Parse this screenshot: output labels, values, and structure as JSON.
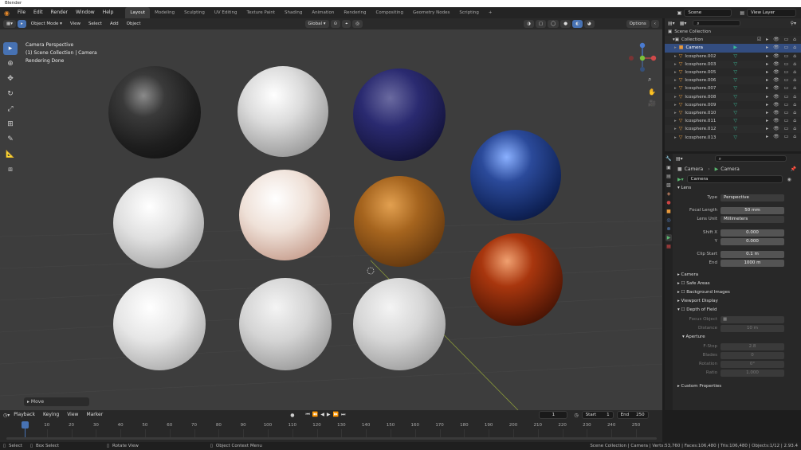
{
  "titlebar": {
    "title": "Blender"
  },
  "menu": {
    "items": [
      "File",
      "Edit",
      "Render",
      "Window",
      "Help"
    ]
  },
  "workspaces": [
    "Layout",
    "Modeling",
    "Sculpting",
    "UV Editing",
    "Texture Paint",
    "Shading",
    "Animation",
    "Rendering",
    "Compositing",
    "Geometry Nodes",
    "Scripting"
  ],
  "active_workspace": "Layout",
  "scene": {
    "label": "Scene",
    "view_layer": "View Layer"
  },
  "viewport_header": {
    "mode": "Object Mode",
    "menus": [
      "View",
      "Select",
      "Add",
      "Object"
    ],
    "orientation": "Global",
    "options": "Options"
  },
  "viewport_info": {
    "line1": "Camera Perspective",
    "line2": "(1) Scene Collection | Camera",
    "line3": "Rendering Done"
  },
  "last_operation": "Move",
  "outliner": {
    "root": "Scene Collection",
    "collection": "Collection",
    "items": [
      "Camera",
      "Icosphere.002",
      "Icosphere.003",
      "Icosphere.005",
      "Icosphere.006",
      "Icosphere.007",
      "Icosphere.008",
      "Icosphere.009",
      "Icosphere.010",
      "Icosphere.011",
      "Icosphere.012",
      "Icosphere.013"
    ]
  },
  "properties": {
    "breadcrumb_object": "Camera",
    "breadcrumb_data": "Camera",
    "datablock_name": "Camera",
    "lens_section": "Lens",
    "type_label": "Type",
    "type_value": "Perspective",
    "focal_label": "Focal Length",
    "focal_value": "50 mm",
    "lens_unit_label": "Lens Unit",
    "lens_unit_value": "Millimeters",
    "shift_x_label": "Shift X",
    "shift_x_value": "0.000",
    "shift_y_label": "Y",
    "shift_y_value": "0.000",
    "clip_start_label": "Clip Start",
    "clip_start_value": "0.1 m",
    "clip_end_label": "End",
    "clip_end_value": "1000 m",
    "sections": [
      "Camera",
      "Safe Areas",
      "Background Images",
      "Viewport Display",
      "Depth of Field"
    ],
    "focus_object_label": "Focus Object",
    "distance_label": "Distance",
    "distance_value": "10 m",
    "aperture_section": "Aperture",
    "fstop_label": "F-Stop",
    "fstop_value": "2.8",
    "blades_label": "Blades",
    "blades_value": "0",
    "rotation_label": "Rotation",
    "rotation_value": "0°",
    "ratio_label": "Ratio",
    "ratio_value": "1.000",
    "custom_props": "Custom Properties"
  },
  "timeline": {
    "menus": [
      "Playback",
      "Keying",
      "View",
      "Marker"
    ],
    "current_frame": "1",
    "start_label": "Start",
    "start_value": "1",
    "end_label": "End",
    "end_value": "250",
    "ticks": [
      "1",
      "10",
      "20",
      "30",
      "40",
      "50",
      "60",
      "70",
      "80",
      "90",
      "100",
      "110",
      "120",
      "130",
      "140",
      "150",
      "160",
      "170",
      "180",
      "190",
      "200",
      "210",
      "220",
      "230",
      "240",
      "250"
    ]
  },
  "statusbar": {
    "select": "Select",
    "box_select": "Box Select",
    "rotate_view": "Rotate View",
    "context_menu": "Object Context Menu",
    "stats": "Scene Collection | Camera | Verts:53,760 | Faces:106,480 | Tris:106,480 | Objects:1/12 | 2.93.4"
  },
  "colors": {
    "accent": "#4772b3",
    "selection": "#334d80",
    "viewport_bg": "#3d3d3d"
  }
}
